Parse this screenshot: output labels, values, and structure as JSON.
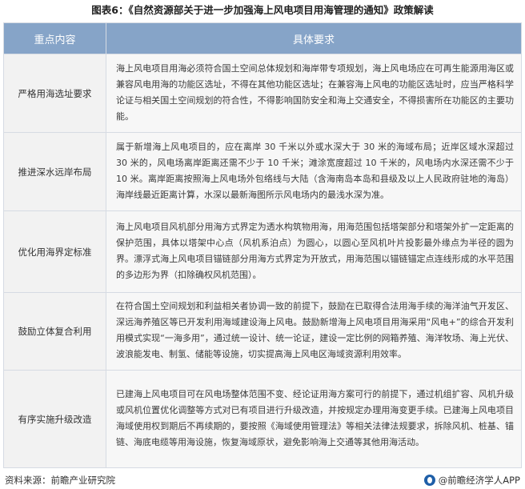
{
  "title": "图表6：《自然资源部关于进一步加强海上风电项目用海管理的通知》政策解读",
  "table": {
    "headers": [
      "重点内容",
      "具体要求"
    ],
    "rows": [
      {
        "key": "严格用海选址要求",
        "text": "海上风电项目用海必须符合国土空间总体规划和海岸带专项规划，海上风电场应在可再生能源用海区或兼容风电用海的功能区选址，不得在其他功能区选址；在兼容海上风电的功能区选址时，应当严格科学论证与相关国土空间规划的符合性，不得影响国防安全和海上交通安全，不得损害所在功能区的主要功能。"
      },
      {
        "key": "推进深水远岸布局",
        "text": "属于新增海上风电项目的，应在离岸 30 千米以外或水深大于 30 米的海域布局；近岸区域水深超过 30 米的，风电场离岸距离还需不少于 10 千米；滩涂宽度超过 10 千米的，风电场内水深还需不少于 10 米。离岸距离按照海上风电场外包络线与大陆（含海南岛本岛和县级及以上人民政府驻地的海岛）海岸线最近距离计算，水深以最新海图所示风电场内的最浅水深为准。"
      },
      {
        "key": "优化用海界定标准",
        "text": "海上风电项目风机部分用海方式界定为透水构筑物用海，用海范围包括塔架部分和塔架外扩一定距离的保护范围，具体以塔架中心点（风机系泊点）为圆心，以圆心至风机叶片投影最外缘点为半径的圆为界。漂浮式海上风电项目锚链部分用海方式界定为开放式，用海范围以锚链锚定点连线形成的水平范围的多边形为界（扣除确权风机范围）。"
      },
      {
        "key": "鼓励立体复合利用",
        "text": "在符合国土空间规划和利益相关者协调一致的前提下，鼓励在已取得合法用海手续的海洋油气开发区、深远海养殖区等已开发利用海域建设海上风电。鼓励新增海上风电项目用海采用“风电+”的综合开发利用模式实现“一海多用”，通过统一设计、统一论证，建设一定比例的网箱养殖、海洋牧场、海上光伏、波浪能发电、制氢、储能等设施，切实提高海上风电区海域资源利用效率。"
      },
      {
        "key": "有序实施升级改造",
        "text": "已建海上风电项目可在风电场整体范围不变、经论证用海方案可行的前提下，通过机组扩容、风机升级或风机位置优化调整等方式对已有项目进行升级改造，并按规定办理用海变更手续。已建海上风电项目海域使用权到期后不再续期的，要按照《海域使用管理法》等相关法律法规要求，拆除风机、桩基、锚链、海底电缆等用海设施，恢复海域原状，避免影响海上交通等其他用海活动。"
      }
    ]
  },
  "footer": {
    "source": "资料来源：前瞻产业研究院",
    "brand": "@前瞻经济学人APP",
    "logo_icon": "qianzhan-logo-icon",
    "logo_color": "#1f5fa8"
  },
  "colors": {
    "header_bg": "#86a4c8",
    "key_bg": "#f2f2f2",
    "cell_bg": "#f7f7f7",
    "border": "#d6dbe3"
  }
}
